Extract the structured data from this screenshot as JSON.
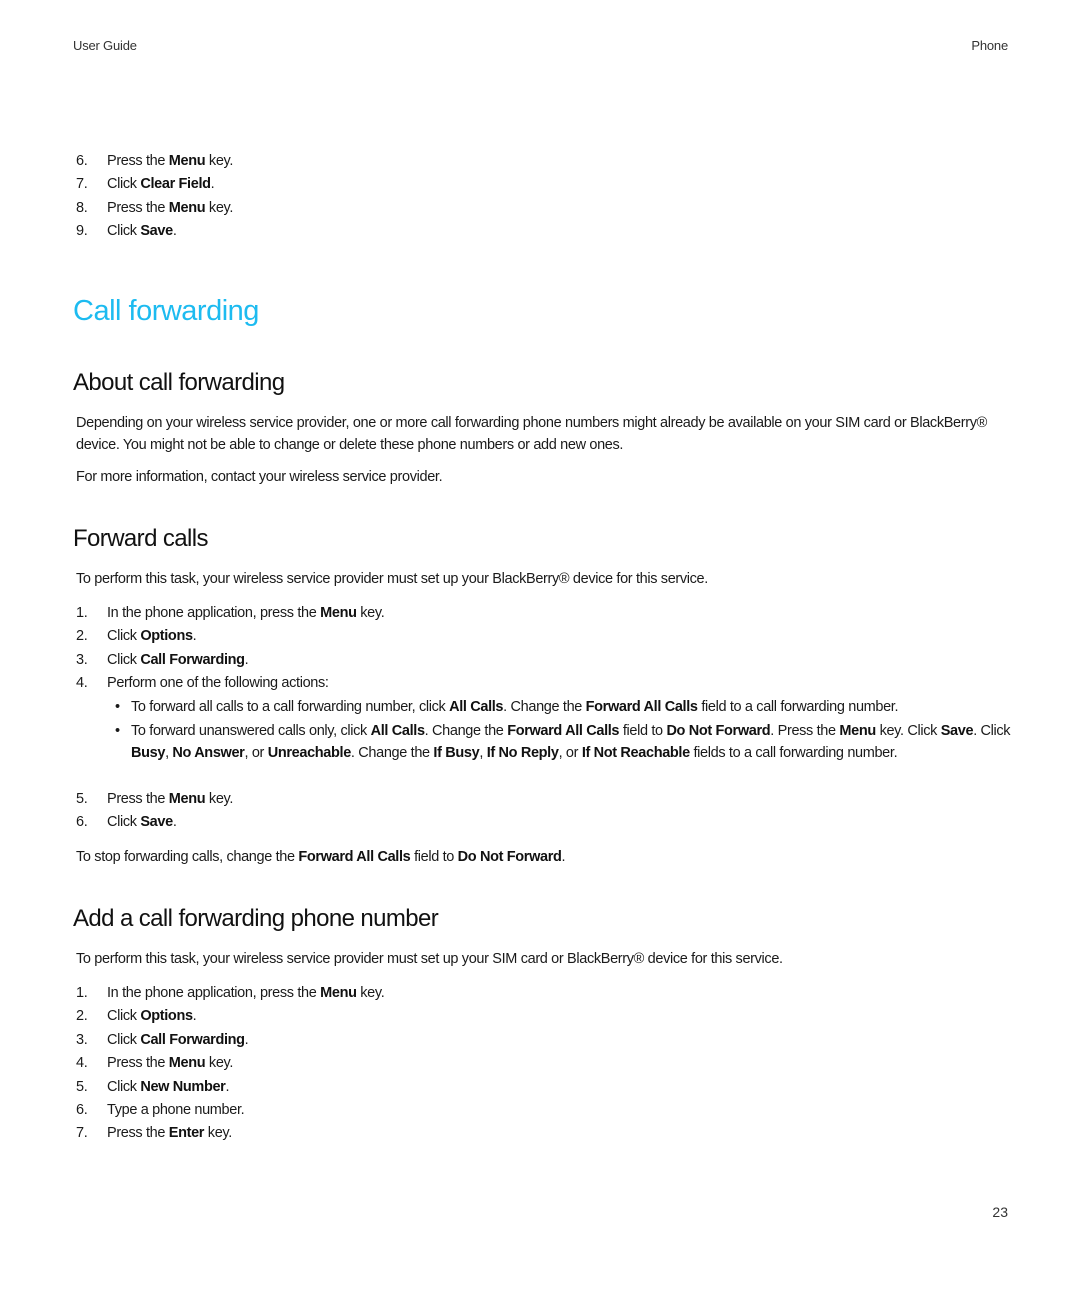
{
  "header": {
    "left": "User Guide",
    "right": "Phone"
  },
  "footer": {
    "page_number": "23"
  },
  "top_steps": [
    {
      "num": "6.",
      "parts": [
        {
          "t": "Press the "
        },
        {
          "t": "Menu",
          "b": true
        },
        {
          "t": " key."
        }
      ]
    },
    {
      "num": "7.",
      "parts": [
        {
          "t": "Click "
        },
        {
          "t": "Clear Field",
          "b": true
        },
        {
          "t": "."
        }
      ]
    },
    {
      "num": "8.",
      "parts": [
        {
          "t": "Press the "
        },
        {
          "t": "Menu",
          "b": true
        },
        {
          "t": " key."
        }
      ]
    },
    {
      "num": "9.",
      "parts": [
        {
          "t": "Click "
        },
        {
          "t": "Save",
          "b": true
        },
        {
          "t": "."
        }
      ]
    }
  ],
  "chapter": {
    "title": "Call forwarding",
    "color": "#1dbbf0"
  },
  "about": {
    "title": "About call forwarding",
    "paragraphs": [
      "Depending on your wireless service provider, one or more call forwarding phone numbers might already be available on your SIM card or BlackBerry® device. You might not be able to change or delete these phone numbers or add new ones.",
      "For more information, contact your wireless service provider."
    ]
  },
  "forward_calls": {
    "title": "Forward calls",
    "intro": "To perform this task, your wireless service provider must set up your BlackBerry® device for this service.",
    "steps_a": [
      {
        "num": "1.",
        "parts": [
          {
            "t": "In the phone application, press the "
          },
          {
            "t": "Menu",
            "b": true
          },
          {
            "t": " key."
          }
        ]
      },
      {
        "num": "2.",
        "parts": [
          {
            "t": "Click "
          },
          {
            "t": "Options",
            "b": true
          },
          {
            "t": "."
          }
        ]
      },
      {
        "num": "3.",
        "parts": [
          {
            "t": "Click "
          },
          {
            "t": "Call Forwarding",
            "b": true
          },
          {
            "t": "."
          }
        ]
      },
      {
        "num": "4.",
        "parts": [
          {
            "t": "Perform one of the following actions:"
          }
        ]
      }
    ],
    "bullets": [
      {
        "parts": [
          {
            "t": "To forward all calls to a call forwarding number, click "
          },
          {
            "t": "All Calls",
            "b": true
          },
          {
            "t": ". Change the "
          },
          {
            "t": "Forward All Calls",
            "b": true
          },
          {
            "t": " field to a call forwarding number."
          }
        ]
      },
      {
        "parts": [
          {
            "t": "To forward unanswered calls only, click "
          },
          {
            "t": "All Calls",
            "b": true
          },
          {
            "t": ". Change the "
          },
          {
            "t": "Forward All Calls",
            "b": true
          },
          {
            "t": " field to "
          },
          {
            "t": "Do Not Forward",
            "b": true
          },
          {
            "t": ". Press the "
          },
          {
            "t": "Menu",
            "b": true
          },
          {
            "t": " key. Click "
          },
          {
            "t": "Save",
            "b": true
          },
          {
            "t": ". Click "
          },
          {
            "t": "Busy",
            "b": true
          },
          {
            "t": ", "
          },
          {
            "t": "No Answer",
            "b": true
          },
          {
            "t": ", or "
          },
          {
            "t": "Unreachable",
            "b": true
          },
          {
            "t": ". Change the "
          },
          {
            "t": "If Busy",
            "b": true
          },
          {
            "t": ", "
          },
          {
            "t": "If No Reply",
            "b": true
          },
          {
            "t": ", or "
          },
          {
            "t": "If Not Reachable",
            "b": true
          },
          {
            "t": " fields to a call forwarding number."
          }
        ]
      }
    ],
    "steps_b": [
      {
        "num": "5.",
        "parts": [
          {
            "t": "Press the "
          },
          {
            "t": "Menu",
            "b": true
          },
          {
            "t": " key."
          }
        ]
      },
      {
        "num": "6.",
        "parts": [
          {
            "t": "Click "
          },
          {
            "t": "Save",
            "b": true
          },
          {
            "t": "."
          }
        ]
      }
    ],
    "outro": [
      {
        "t": "To stop forwarding calls, change the "
      },
      {
        "t": "Forward All Calls",
        "b": true
      },
      {
        "t": " field to "
      },
      {
        "t": "Do Not Forward",
        "b": true
      },
      {
        "t": "."
      }
    ]
  },
  "add_number": {
    "title": "Add a call forwarding phone number",
    "intro": "To perform this task, your wireless service provider must set up your SIM card or BlackBerry® device for this service.",
    "steps": [
      {
        "num": "1.",
        "parts": [
          {
            "t": "In the phone application, press the "
          },
          {
            "t": "Menu",
            "b": true
          },
          {
            "t": " key."
          }
        ]
      },
      {
        "num": "2.",
        "parts": [
          {
            "t": "Click "
          },
          {
            "t": "Options",
            "b": true
          },
          {
            "t": "."
          }
        ]
      },
      {
        "num": "3.",
        "parts": [
          {
            "t": "Click "
          },
          {
            "t": "Call Forwarding",
            "b": true
          },
          {
            "t": "."
          }
        ]
      },
      {
        "num": "4.",
        "parts": [
          {
            "t": "Press the "
          },
          {
            "t": "Menu",
            "b": true
          },
          {
            "t": " key."
          }
        ]
      },
      {
        "num": "5.",
        "parts": [
          {
            "t": "Click "
          },
          {
            "t": "New Number",
            "b": true
          },
          {
            "t": "."
          }
        ]
      },
      {
        "num": "6.",
        "parts": [
          {
            "t": "Type a phone number."
          }
        ]
      },
      {
        "num": "7.",
        "parts": [
          {
            "t": "Press the "
          },
          {
            "t": "Enter",
            "b": true
          },
          {
            "t": " key."
          }
        ]
      }
    ]
  }
}
